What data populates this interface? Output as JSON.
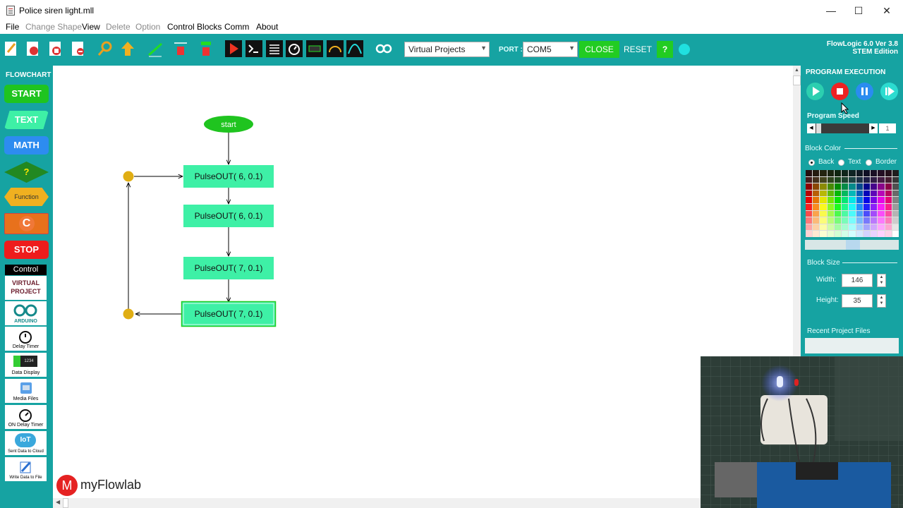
{
  "window": {
    "title": "Police siren light.mll",
    "minimize": "—",
    "maximize": "☐",
    "close": "✕"
  },
  "menu": [
    "File",
    "Change Shape",
    "View",
    "Delete",
    "Option",
    "Control Blocks",
    "Comm",
    "About"
  ],
  "toolbar": {
    "project_select": "Virtual Projects",
    "port_label": "PORT :",
    "port_value": "COM5",
    "close_label": "CLOSE",
    "reset_label": "RESET",
    "help_label": "?",
    "version_line1": "FlowLogic 6.0 Ver 3.8",
    "version_line2": "STEM Edition"
  },
  "flowchart_panel": {
    "heading": "FLOWCHART",
    "blocks": {
      "start": "START",
      "text": "TEXT",
      "math": "MATH",
      "decision": "?",
      "function": "Function",
      "c": "C",
      "stop": "STOP"
    },
    "control_heading": "Control",
    "tools": {
      "virtual_project_line1": "VIRTUAL",
      "virtual_project_line2": "PROJECT",
      "arduino": "ARDUINO",
      "delay_timer": "Delay Timer",
      "data_display": "Data Display",
      "data_display_screen": "1234",
      "media_files": "Media Files",
      "on_delay_timer": "ON Delay Timer",
      "iot_badge": "IoT",
      "sent_data_cloud": "Sent Data to Cloud",
      "write_data_file": "Write Data to File"
    }
  },
  "diagram": {
    "start_label": "start",
    "blocks": [
      "PulseOUT( 6, 0.1)",
      "PulseOUT( 6, 0.1)",
      "PulseOUT( 7, 0.1)",
      "PulseOUT( 7, 0.1)"
    ]
  },
  "program_execution": {
    "heading": "PROGRAM EXECUTION",
    "speed_label": "Program Speed",
    "speed_value": "1",
    "block_color_label": "Block Color",
    "radio_back": "Back",
    "radio_text": "Text",
    "radio_border": "Border",
    "block_size_label": "Block Size",
    "width_label": "Width:",
    "width_value": "146",
    "height_label": "Height:",
    "height_value": "35",
    "recent_files_label": "Recent Project Files"
  },
  "colors": {
    "teal": "#16a3a2",
    "block_green": "#3ef0a6",
    "start_green": "#1fc41f",
    "stop_red": "#ee1c1c",
    "junction": "#e0ae14"
  },
  "logo": {
    "mark": "M",
    "text": "myFlowlab"
  }
}
